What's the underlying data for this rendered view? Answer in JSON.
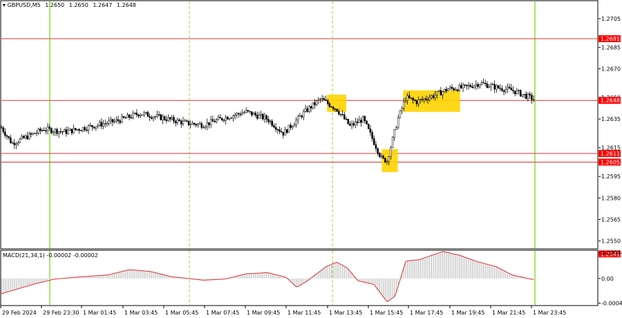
{
  "chart_data": [
    {
      "type": "candlestick",
      "header": {
        "symbol_label": "GBPUSD,M5",
        "open": "1.2650",
        "high": "1.2650",
        "low": "1.2647",
        "close": "1.2648"
      },
      "y_ticks": [
        "1.2705",
        "1.2685",
        "1.2670",
        "1.2650",
        "1.2635",
        "1.2615",
        "1.2595",
        "1.2580",
        "1.2565",
        "1.2550"
      ],
      "ylim": [
        1.2545,
        1.2717
      ],
      "x_ticks": [
        "29 Feb 2024",
        "29 Feb 23:30",
        "1 Mar 01:45",
        "1 Mar 03:45",
        "1 Mar 05:45",
        "1 Mar 07:45",
        "1 Mar 09:45",
        "1 Mar 11:45",
        "1 Mar 13:45",
        "1 Mar 15:45",
        "1 Mar 17:45",
        "1 Mar 19:45",
        "1 Mar 21:45",
        "1 Mar 23:45"
      ],
      "horizontal_levels": [
        {
          "label": "1.2691",
          "value": 1.2691
        },
        {
          "label": "1.2648",
          "value": 1.2648
        },
        {
          "label": "1.2611",
          "value": 1.2611
        },
        {
          "label": "1.2605",
          "value": 1.2605
        },
        {
          "label": "1.2541",
          "value": 1.2541
        }
      ],
      "close_path": [
        [
          0,
          1.2629
        ],
        [
          0.02,
          1.2618
        ],
        [
          0.05,
          1.2623
        ],
        [
          0.08,
          1.2628
        ],
        [
          0.12,
          1.2626
        ],
        [
          0.17,
          1.263
        ],
        [
          0.22,
          1.2634
        ],
        [
          0.26,
          1.2639
        ],
        [
          0.3,
          1.2636
        ],
        [
          0.35,
          1.2632
        ],
        [
          0.38,
          1.2631
        ],
        [
          0.42,
          1.2636
        ],
        [
          0.46,
          1.264
        ],
        [
          0.5,
          1.2635
        ],
        [
          0.53,
          1.2625
        ],
        [
          0.57,
          1.264
        ],
        [
          0.6,
          1.2649
        ],
        [
          0.63,
          1.2642
        ],
        [
          0.655,
          1.263
        ],
        [
          0.68,
          1.2635
        ],
        [
          0.715,
          1.2607
        ],
        [
          0.725,
          1.2606
        ],
        [
          0.745,
          1.2635
        ],
        [
          0.76,
          1.265
        ],
        [
          0.78,
          1.2647
        ],
        [
          0.81,
          1.2651
        ],
        [
          0.84,
          1.2656
        ],
        [
          0.87,
          1.2657
        ],
        [
          0.9,
          1.266
        ],
        [
          0.93,
          1.2657
        ],
        [
          0.96,
          1.2655
        ],
        [
          1.0,
          1.2649
        ]
      ],
      "highlight_zones": [
        {
          "t0": 0.612,
          "t1": 0.648,
          "low": 1.264,
          "high": 1.2652
        },
        {
          "t0": 0.715,
          "t1": 0.745,
          "low": 1.2598,
          "high": 1.2614
        },
        {
          "t0": 0.755,
          "t1": 0.862,
          "low": 1.264,
          "high": 1.2655
        }
      ],
      "colors": {
        "level_line": "#e03030",
        "level_tag": "#ff0000",
        "highlight": "#ffd400",
        "session_line": "#6fd400",
        "candle": "#000000"
      }
    },
    {
      "type": "bar",
      "indicator_label": "MACD(21,34,1) -0.00002 -0.00002",
      "y_ticks": [
        "0.00044",
        "0.00",
        "-0.00042"
      ],
      "ylim": [
        -0.00045,
        0.00047
      ],
      "values_path": [
        [
          0,
          -0.00026
        ],
        [
          0.06,
          -0.0001
        ],
        [
          0.1,
          -1e-05
        ],
        [
          0.15,
          3e-05
        ],
        [
          0.2,
          6e-05
        ],
        [
          0.24,
          0.00015
        ],
        [
          0.28,
          0.00012
        ],
        [
          0.32,
          3e-05
        ],
        [
          0.38,
          -3e-05
        ],
        [
          0.42,
          -1e-05
        ],
        [
          0.46,
          8e-05
        ],
        [
          0.5,
          0.0001
        ],
        [
          0.535,
          2e-05
        ],
        [
          0.555,
          -0.00015
        ],
        [
          0.575,
          -4e-05
        ],
        [
          0.61,
          0.0002
        ],
        [
          0.63,
          0.00028
        ],
        [
          0.65,
          0.00018
        ],
        [
          0.67,
          -4e-05
        ],
        [
          0.7,
          -0.0001
        ],
        [
          0.725,
          -0.0004
        ],
        [
          0.74,
          -0.0003
        ],
        [
          0.76,
          0.0003
        ],
        [
          0.785,
          0.00032
        ],
        [
          0.81,
          0.0004
        ],
        [
          0.83,
          0.00046
        ],
        [
          0.86,
          0.0004
        ],
        [
          0.89,
          0.0003
        ],
        [
          0.93,
          0.0002
        ],
        [
          0.96,
          6e-05
        ],
        [
          1.0,
          -2e-05
        ]
      ],
      "colors": {
        "bars": "#c0c0c0",
        "signal": "#e03030"
      }
    }
  ]
}
